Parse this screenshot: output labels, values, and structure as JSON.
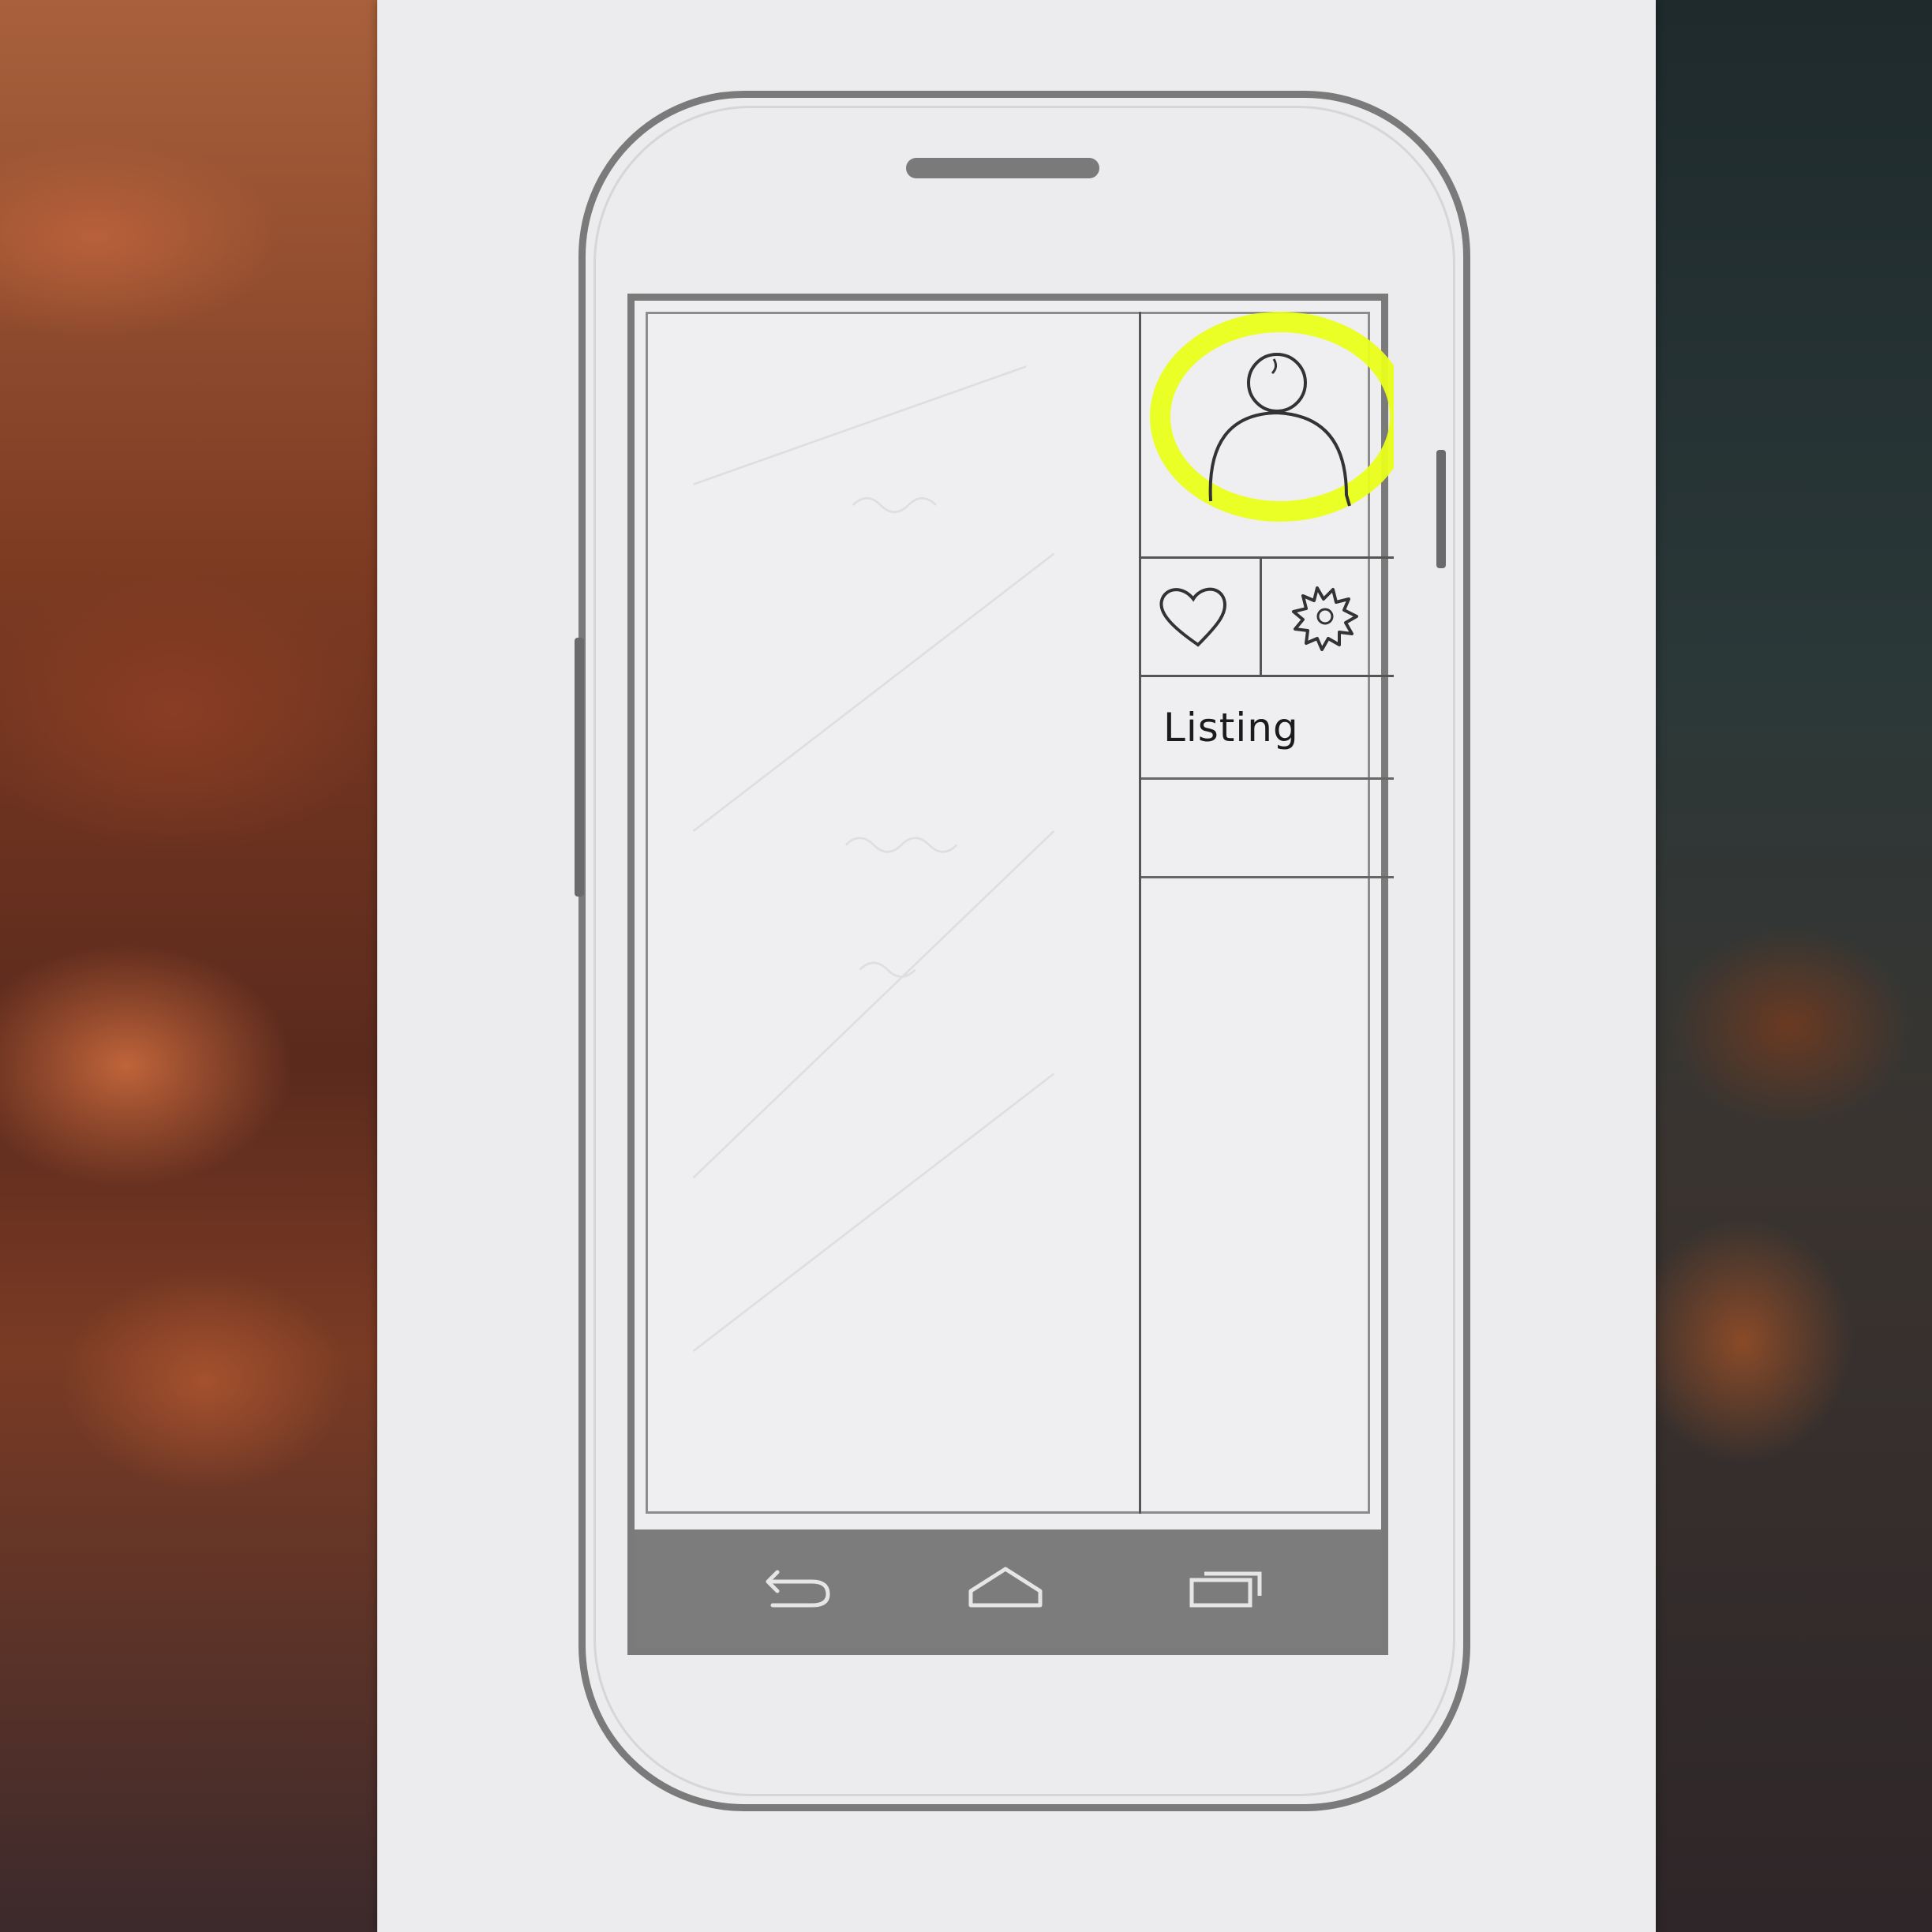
{
  "drawer": {
    "listing_label": "Listing"
  },
  "icons": {
    "avatar": "user-avatar-icon",
    "favorite": "heart-icon",
    "settings": "gear-icon",
    "back": "back-icon",
    "home": "home-icon",
    "recents": "recents-icon"
  },
  "colors": {
    "highlight": "#e9ff1a",
    "navbar": "#7c7c7c",
    "frame": "#7a7a7a"
  }
}
